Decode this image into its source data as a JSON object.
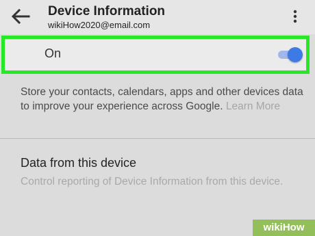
{
  "header": {
    "title": "Device Information",
    "account": "wikiHow2020@email.com"
  },
  "toggle": {
    "label": "On",
    "state": "on",
    "accent_color": "#3d7ae6",
    "highlight_color": "#27e827"
  },
  "description": {
    "text": "Store your contacts, calendars, apps and other devices data to improve your experience across Google.",
    "link": "Learn More"
  },
  "data_section": {
    "title": "Data from this device",
    "description": "Control reporting of Device Information from this device."
  },
  "watermark": {
    "text": "wikiHow"
  },
  "icons": [
    "back-arrow-icon",
    "more-vert-icon"
  ]
}
